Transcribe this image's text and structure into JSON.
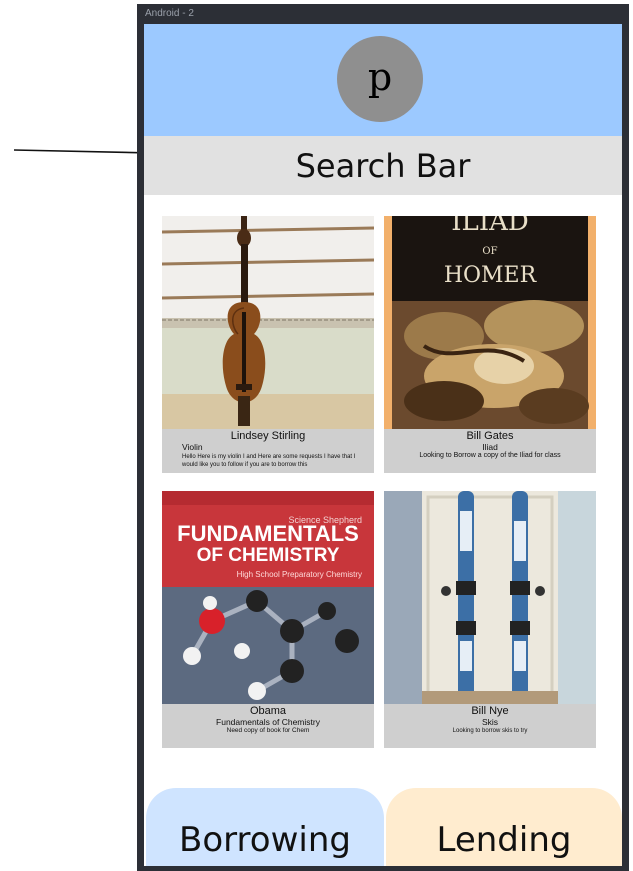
{
  "frame": {
    "label": "Android - 2"
  },
  "header": {
    "avatar_letter": "p"
  },
  "search": {
    "label": "Search Bar"
  },
  "cards": [
    {
      "name": "Lindsey Stirling",
      "title": "Violin",
      "description": "Hello Here is my violin I and Here are some requests I have that I would like you to follow if you are to borrow this",
      "image": "violin-photo"
    },
    {
      "name": "Bill Gates",
      "title": "Iliad",
      "description": "Looking to Borrow a copy of the Iliad for class",
      "image": "iliad-book-cover",
      "cover_text_top": "ILIAD",
      "cover_text_of": "OF",
      "cover_text_author": "HOMER"
    },
    {
      "name": "Obama",
      "title": "Fundamentals of Chemistry",
      "description": "Need copy of book for Chem",
      "image": "chemistry-book-cover",
      "cover_publisher": "Science Shepherd",
      "cover_line1": "FUNDAMENTALS",
      "cover_line2": "OF CHEMISTRY",
      "cover_subtitle": "High School Preparatory Chemistry"
    },
    {
      "name": "Bill Nye",
      "title": "Skis",
      "description": "Looking to borrow skis to try",
      "image": "skis-photo"
    }
  ],
  "tabs": {
    "borrowing": "Borrowing",
    "lending": "Lending"
  },
  "colors": {
    "header": "#9cc9ff",
    "search_bar": "#e1e1e1",
    "avatar": "#8f8f8f",
    "card_caption": "#cfcfcf",
    "borrowing_tab": "#cfe4ff",
    "lending_tab": "#ffeccf",
    "frame": "#2c2f36"
  }
}
